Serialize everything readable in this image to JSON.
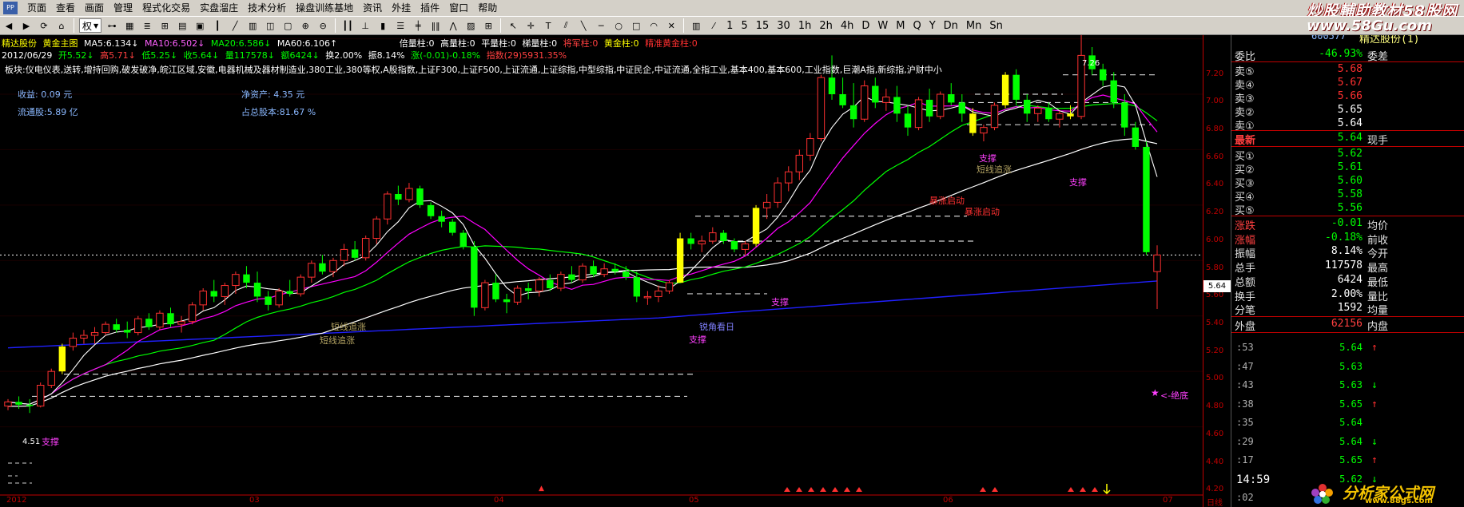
{
  "menu": {
    "logo": "PP",
    "items": [
      "页面",
      "查看",
      "画面",
      "管理",
      "程式化交易",
      "实盘溜庄",
      "技术分析",
      "操盘训练基地",
      "资讯",
      "外挂",
      "插件",
      "窗口",
      "帮助"
    ]
  },
  "watermarks": {
    "title": "炒股輔助教材58股网",
    "url": "www.58Gu.com",
    "bottom_cn": "分析家公式网",
    "bottom_url": "www.88gs.com"
  },
  "toolbar": {
    "rights_label": "权",
    "periods": [
      "1",
      "5",
      "15",
      "30",
      "1h",
      "2h",
      "4h",
      "D",
      "W",
      "M",
      "Q",
      "Y",
      "Dn",
      "Mn",
      "Sn"
    ]
  },
  "legend": {
    "stock": "精达股份",
    "chart": "黄金主图",
    "ma5": "MA5:6.134↓",
    "ma10": "MA10:6.502↓",
    "ma20": "MA20:6.586↓",
    "ma60": "MA60:6.106↑",
    "beilang": "倍量柱:0",
    "gaoliang": "高量柱:0",
    "pingliang": "平量柱:0",
    "tiliang": "梯量柱:0",
    "jiangjun": "将军柱:0",
    "huangjin": "黄金柱:0",
    "jingzhun": "精准黄金柱:0"
  },
  "ohlc": {
    "date": "2012/06/29",
    "open": "开5.52↓",
    "high": "高5.71↓",
    "low": "低5.25↓",
    "close": "收5.64↓",
    "volume": "量117578↓",
    "amount": "额6424↓",
    "turnover": "换2.00%",
    "amplitude": "振8.14%",
    "change": "涨(-0.01)-0.18%",
    "index": "指数(29)5931.35%"
  },
  "sector": "板块:仪电仪表,送转,增持回购,破发破净,皖江区域,安徽,电器机械及器材制造业,380工业,380等权,A股指数,上证F300,上证F500,上证流通,上证综指,中型综指,中证民企,中证流通,全指工业,基本400,基本600,工业指数,巨潮A指,新综指,沪财中小",
  "fundamentals": {
    "eps": "收益:  0.09 元",
    "nav": "净资产:  4.35 元",
    "float": "流通股:5.89 亿",
    "ratio": "占总股本:81.67 %"
  },
  "annotations": {
    "zhicheng": "支撑",
    "duanxian": "短线追涨",
    "baozhang": "暴涨启动",
    "jueduishi": "<-绝底",
    "yingtou": "锐角看日"
  },
  "price_axis": {
    "labels": [
      "7.20",
      "7.00",
      "6.80",
      "6.60",
      "6.40",
      "6.20",
      "6.00",
      "5.80",
      "5.60",
      "5.40",
      "5.20",
      "5.00",
      "4.80",
      "4.60",
      "4.40",
      "4.20"
    ],
    "high_marker": "7.26",
    "low_marker": "4.51",
    "current": "5.64"
  },
  "date_axis": {
    "labels": [
      "2012",
      "03",
      "04",
      "05",
      "06",
      "07"
    ],
    "right_label": "日线"
  },
  "panel": {
    "code": "600577",
    "name": "精达股份(1)",
    "weibi_label": "委比",
    "weibi_value": "-46.93%",
    "weicha_label": "委差",
    "asks": [
      {
        "label": "卖⑤",
        "price": "5.68"
      },
      {
        "label": "卖④",
        "price": "5.67"
      },
      {
        "label": "卖③",
        "price": "5.66"
      },
      {
        "label": "卖②",
        "price": "5.65"
      },
      {
        "label": "卖①",
        "price": "5.64"
      }
    ],
    "last_label": "最新",
    "last_value": "5.64",
    "last_right": "现手",
    "bids": [
      {
        "label": "买①",
        "price": "5.62"
      },
      {
        "label": "买②",
        "price": "5.61"
      },
      {
        "label": "买③",
        "price": "5.60"
      },
      {
        "label": "买④",
        "price": "5.58"
      },
      {
        "label": "买⑤",
        "price": "5.56"
      }
    ],
    "stats": [
      {
        "label": "涨跌",
        "value": "-0.01",
        "right": "均价",
        "color": "#00ff00"
      },
      {
        "label": "涨幅",
        "value": "-0.18%",
        "right": "前收",
        "color": "#00ff00"
      },
      {
        "label": "振幅",
        "value": "8.14%",
        "right": "今开",
        "color": "#ffffff"
      },
      {
        "label": "总手",
        "value": "117578",
        "right": "最高",
        "color": "#ffffff"
      },
      {
        "label": "总额",
        "value": "6424",
        "right": "最低",
        "color": "#ffffff"
      },
      {
        "label": "换手",
        "value": "2.00%",
        "right": "量比",
        "color": "#ffffff"
      },
      {
        "label": "分笔",
        "value": "1592",
        "right": "均量",
        "color": "#ffffff"
      }
    ],
    "outer_label": "外盘",
    "outer_value": "62156",
    "inner_label": "内盘",
    "ticks": [
      {
        "t": ":53",
        "p": "5.64",
        "dir": "up"
      },
      {
        "t": ":47",
        "p": "5.63",
        "dir": ""
      },
      {
        "t": ":43",
        "p": "5.63",
        "dir": "down"
      },
      {
        "t": ":38",
        "p": "5.65",
        "dir": "up"
      },
      {
        "t": ":35",
        "p": "5.64",
        "dir": ""
      },
      {
        "t": ":29",
        "p": "5.64",
        "dir": "down"
      },
      {
        "t": ":17",
        "p": "5.65",
        "dir": "up"
      },
      {
        "t": "14:59",
        "p": "5.62",
        "dir": "down"
      },
      {
        "t": ":02",
        "p": "",
        "dir": ""
      }
    ]
  },
  "colors": {
    "up": "#ff3030",
    "down": "#00ff00",
    "white": "#ffffff",
    "ma5": "#ffffff",
    "ma10": "#ff00ff",
    "ma20": "#00ff00",
    "ma60": "#ffffff",
    "ma120": "#2020ff",
    "gold": "#ffff00",
    "axis": "#c00000"
  },
  "chart_data": {
    "type": "candlestick",
    "y_range": [
      4.15,
      7.33
    ],
    "candles": [
      [
        4.55,
        4.6,
        4.52,
        4.58
      ],
      [
        4.58,
        4.62,
        4.53,
        4.56
      ],
      [
        4.56,
        4.6,
        4.5,
        4.55
      ],
      [
        4.55,
        4.72,
        4.54,
        4.7
      ],
      [
        4.7,
        4.82,
        4.68,
        4.8
      ],
      [
        4.8,
        5.0,
        4.78,
        4.98
      ],
      [
        4.98,
        5.08,
        4.95,
        5.04
      ],
      [
        5.04,
        5.1,
        5.0,
        5.06
      ],
      [
        5.06,
        5.12,
        5.0,
        5.08
      ],
      [
        5.08,
        5.16,
        5.06,
        5.14
      ],
      [
        5.14,
        5.18,
        5.08,
        5.1
      ],
      [
        5.1,
        5.16,
        5.04,
        5.08
      ],
      [
        5.08,
        5.2,
        5.06,
        5.18
      ],
      [
        5.18,
        5.22,
        5.1,
        5.12
      ],
      [
        5.12,
        5.24,
        5.1,
        5.22
      ],
      [
        5.22,
        5.26,
        5.12,
        5.14
      ],
      [
        5.14,
        5.2,
        5.08,
        5.16
      ],
      [
        5.16,
        5.3,
        5.14,
        5.28
      ],
      [
        5.28,
        5.4,
        5.24,
        5.38
      ],
      [
        5.38,
        5.46,
        5.3,
        5.34
      ],
      [
        5.34,
        5.44,
        5.28,
        5.42
      ],
      [
        5.42,
        5.52,
        5.36,
        5.5
      ],
      [
        5.5,
        5.56,
        5.4,
        5.44
      ],
      [
        5.44,
        5.52,
        5.3,
        5.34
      ],
      [
        5.34,
        5.38,
        5.24,
        5.28
      ],
      [
        5.28,
        5.4,
        5.26,
        5.38
      ],
      [
        5.38,
        5.46,
        5.34,
        5.36
      ],
      [
        5.36,
        5.5,
        5.34,
        5.48
      ],
      [
        5.48,
        5.6,
        5.44,
        5.58
      ],
      [
        5.58,
        5.64,
        5.5,
        5.52
      ],
      [
        5.52,
        5.62,
        5.48,
        5.6
      ],
      [
        5.6,
        5.72,
        5.56,
        5.68
      ],
      [
        5.68,
        5.74,
        5.6,
        5.62
      ],
      [
        5.62,
        5.78,
        5.6,
        5.76
      ],
      [
        5.76,
        5.92,
        5.72,
        5.9
      ],
      [
        5.9,
        6.1,
        5.86,
        6.08
      ],
      [
        6.08,
        6.14,
        6.0,
        6.04
      ],
      [
        6.04,
        6.16,
        6.02,
        6.12
      ],
      [
        6.12,
        6.14,
        5.98,
        6.0
      ],
      [
        6.0,
        6.02,
        5.9,
        5.92
      ],
      [
        5.92,
        5.96,
        5.84,
        5.88
      ],
      [
        5.88,
        5.9,
        5.78,
        5.8
      ],
      [
        5.8,
        5.82,
        5.68,
        5.7
      ],
      [
        5.7,
        5.74,
        5.2,
        5.26
      ],
      [
        5.26,
        5.46,
        5.24,
        5.44
      ],
      [
        5.44,
        5.5,
        5.3,
        5.32
      ],
      [
        5.32,
        5.36,
        5.22,
        5.3
      ],
      [
        5.3,
        5.42,
        5.28,
        5.4
      ],
      [
        5.4,
        5.44,
        5.32,
        5.38
      ],
      [
        5.38,
        5.48,
        5.34,
        5.46
      ],
      [
        5.46,
        5.5,
        5.38,
        5.4
      ],
      [
        5.4,
        5.52,
        5.38,
        5.5
      ],
      [
        5.5,
        5.56,
        5.44,
        5.46
      ],
      [
        5.46,
        5.58,
        5.44,
        5.56
      ],
      [
        5.56,
        5.6,
        5.48,
        5.5
      ],
      [
        5.5,
        5.58,
        5.48,
        5.54
      ],
      [
        5.54,
        5.58,
        5.5,
        5.52
      ],
      [
        5.52,
        5.56,
        5.46,
        5.48
      ],
      [
        5.48,
        5.52,
        5.3,
        5.34
      ],
      [
        5.34,
        5.38,
        5.28,
        5.34
      ],
      [
        5.34,
        5.42,
        5.3,
        5.38
      ],
      [
        5.38,
        5.46,
        5.36,
        5.44
      ],
      [
        5.44,
        5.8,
        5.44,
        5.76
      ],
      [
        5.76,
        5.8,
        5.68,
        5.72
      ],
      [
        5.72,
        5.78,
        5.66,
        5.74
      ],
      [
        5.74,
        5.84,
        5.72,
        5.8
      ],
      [
        5.8,
        5.82,
        5.72,
        5.74
      ],
      [
        5.74,
        5.76,
        5.66,
        5.68
      ],
      [
        5.68,
        5.74,
        5.64,
        5.72
      ],
      [
        5.72,
        6.0,
        5.7,
        5.98
      ],
      [
        5.98,
        6.08,
        5.9,
        6.02
      ],
      [
        6.02,
        6.2,
        5.98,
        6.16
      ],
      [
        6.16,
        6.28,
        6.1,
        6.24
      ],
      [
        6.24,
        6.4,
        6.18,
        6.36
      ],
      [
        6.36,
        6.52,
        6.32,
        6.48
      ],
      [
        6.48,
        6.94,
        6.46,
        6.92
      ],
      [
        6.92,
        7.08,
        6.76,
        6.8
      ],
      [
        6.8,
        6.92,
        6.7,
        6.72
      ],
      [
        6.72,
        6.88,
        6.56,
        6.62
      ],
      [
        6.62,
        6.9,
        6.6,
        6.86
      ],
      [
        6.86,
        6.92,
        6.7,
        6.74
      ],
      [
        6.74,
        6.84,
        6.68,
        6.78
      ],
      [
        6.78,
        6.86,
        6.6,
        6.66
      ],
      [
        6.66,
        6.72,
        6.5,
        6.56
      ],
      [
        6.56,
        6.78,
        6.54,
        6.76
      ],
      [
        6.76,
        6.84,
        6.6,
        6.64
      ],
      [
        6.64,
        6.82,
        6.62,
        6.8
      ],
      [
        6.8,
        6.88,
        6.72,
        6.74
      ],
      [
        6.74,
        6.8,
        6.6,
        6.66
      ],
      [
        6.66,
        6.7,
        6.5,
        6.52
      ],
      [
        6.52,
        6.58,
        6.46,
        6.56
      ],
      [
        6.56,
        6.74,
        6.54,
        6.72
      ],
      [
        6.72,
        6.96,
        6.7,
        6.94
      ],
      [
        6.94,
        6.98,
        6.72,
        6.76
      ],
      [
        6.76,
        6.8,
        6.6,
        6.66
      ],
      [
        6.66,
        6.72,
        6.6,
        6.7
      ],
      [
        6.7,
        6.74,
        6.6,
        6.62
      ],
      [
        6.62,
        6.68,
        6.56,
        6.66
      ],
      [
        6.66,
        6.72,
        6.62,
        6.64
      ],
      [
        6.64,
        7.26,
        6.62,
        7.08
      ],
      [
        7.08,
        7.14,
        6.94,
        6.98
      ],
      [
        6.98,
        7.02,
        6.86,
        6.9
      ],
      [
        6.9,
        6.96,
        6.7,
        6.74
      ],
      [
        6.74,
        6.8,
        6.5,
        6.56
      ],
      [
        6.56,
        6.6,
        6.4,
        6.42
      ],
      [
        6.42,
        6.46,
        5.64,
        5.66
      ],
      [
        5.52,
        5.71,
        5.25,
        5.64
      ]
    ],
    "gold_bars": [
      5,
      62,
      69,
      89,
      92,
      98
    ],
    "ma_series": [
      "MA5",
      "MA10",
      "MA20",
      "MA60",
      "MA120"
    ]
  }
}
